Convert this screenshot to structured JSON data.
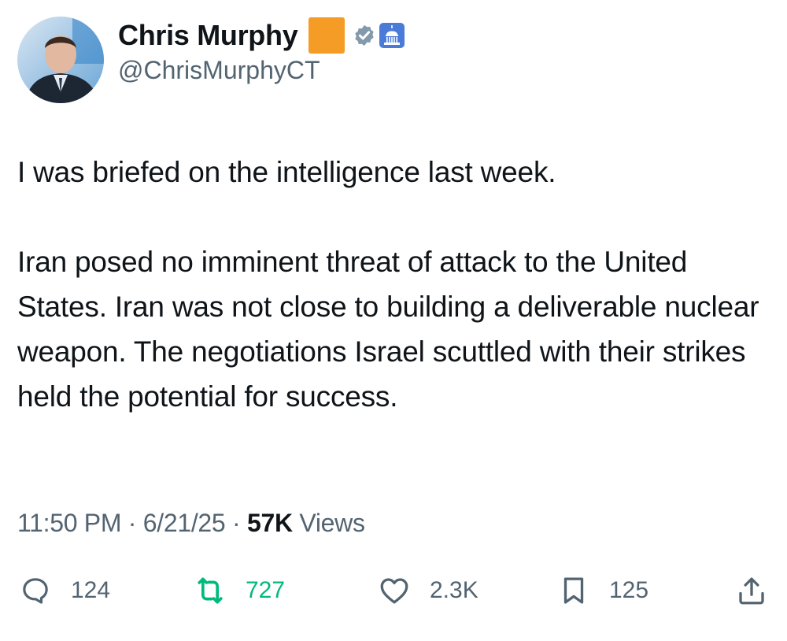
{
  "author": {
    "display_name": "Chris Murphy",
    "handle": "@ChrisMurphyCT",
    "emoji_color": "#f59c26",
    "verified_icon": "verified-badge-icon",
    "affiliation_icon": "capitol-building-icon"
  },
  "tweet": {
    "paragraphs": [
      "I was briefed on the intelligence last week.",
      "Iran posed no imminent threat of attack to the United States. Iran was not close to building a deliverable nuclear weapon. The negotiations Israel scuttled with their strikes held the potential for success."
    ]
  },
  "meta": {
    "time": "11:50 PM",
    "sep1": "·",
    "date": "6/21/25",
    "sep2": "·",
    "views_count": "57K",
    "views_label": "Views"
  },
  "actions": {
    "replies": "124",
    "retweets": "727",
    "likes": "2.3K",
    "bookmarks": "125"
  },
  "colors": {
    "text": "#0f1419",
    "secondary": "#536471",
    "retweet_active": "#00ba7c",
    "verified": "#829aab",
    "affiliation_badge": "#4a7bd8"
  }
}
